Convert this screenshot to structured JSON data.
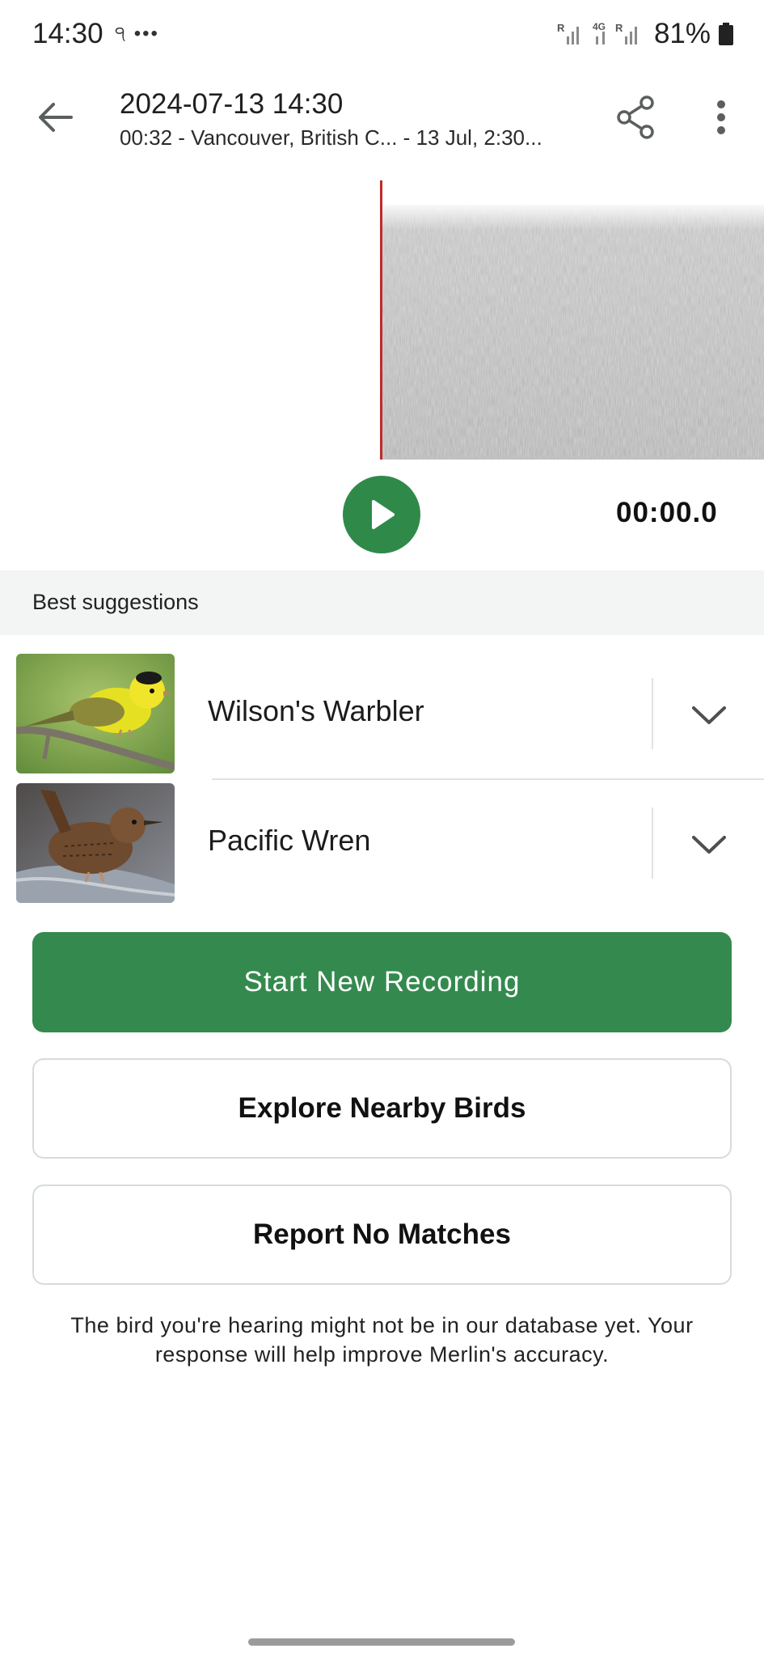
{
  "status_bar": {
    "time": "14:30",
    "left_icons": "੧ •••",
    "battery": "81%"
  },
  "app_bar": {
    "title": "2024-07-13 14:30",
    "subtitle": "00:32 - Vancouver, British C... - 13 Jul, 2:30..."
  },
  "player": {
    "timer": "00:00.0"
  },
  "suggestions": {
    "header": "Best suggestions",
    "items": [
      {
        "name": "Wilson's Warbler"
      },
      {
        "name": "Pacific Wren"
      }
    ]
  },
  "actions": {
    "start_recording": "Start New Recording",
    "explore": "Explore Nearby Birds",
    "report": "Report No Matches"
  },
  "footer_note": "The bird you're hearing might not be in our database yet. Your response will help improve Merlin's accuracy.",
  "colors": {
    "accent_green": "#348a4e",
    "playhead_red": "#c22a2a"
  },
  "icons": [
    "back-arrow-icon",
    "share-icon",
    "more-vert-icon",
    "play-icon",
    "chevron-down-icon",
    "battery-icon",
    "signal-icon"
  ]
}
